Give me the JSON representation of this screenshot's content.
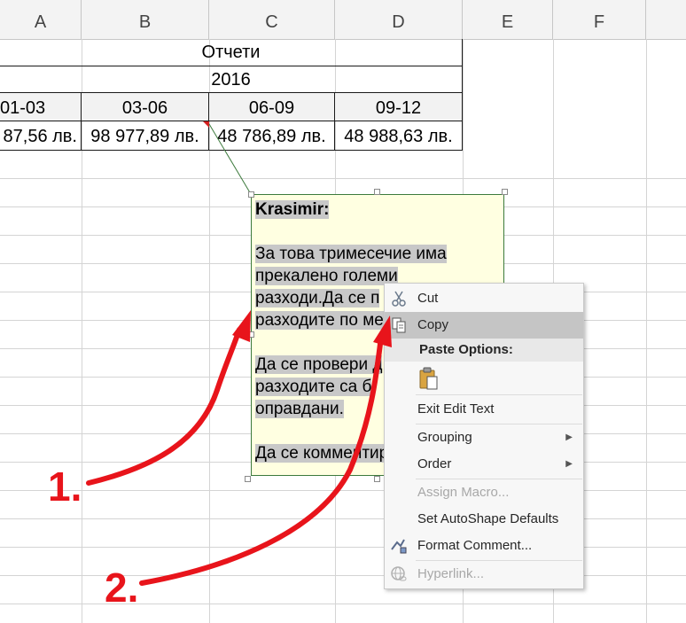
{
  "columns": [
    "A",
    "B",
    "C",
    "D",
    "E",
    "F"
  ],
  "table": {
    "title": "Отчети",
    "year": "2016",
    "periods": [
      "01-03",
      "03-06",
      "06-09",
      "09-12"
    ],
    "values": [
      "87,56 лв.",
      "98 977,89 лв.",
      "48 786,89 лв.",
      "48 988,63 лв."
    ]
  },
  "comment": {
    "author": "Krasimir:",
    "lines1": [
      "За това тримесечие има",
      "прекалено големи",
      "разходи.Да се п",
      "разходите по ме"
    ],
    "lines2": [
      "Да се провери д",
      "разходите са б",
      "оправдани."
    ],
    "lines3": [
      "Да се комментир"
    ]
  },
  "context_menu": {
    "cut": "Cut",
    "copy": "Copy",
    "paste_options": "Paste Options:",
    "exit_edit_text": "Exit Edit Text",
    "grouping": "Grouping",
    "order": "Order",
    "assign_macro": "Assign Macro...",
    "set_autoshape_defaults": "Set AutoShape Defaults",
    "format_comment": "Format Comment...",
    "hyperlink": "Hyperlink..."
  },
  "icons": {
    "cut": "scissors-icon",
    "copy": "copy-icon",
    "paste": "clipboard-icon",
    "format_comment": "format-comment-icon",
    "hyperlink": "globe-link-icon"
  },
  "callouts": [
    "1.",
    "2."
  ],
  "colors": {
    "comment_bg": "#ffffe1",
    "comment_border": "#3c7a3c",
    "annotation_red": "#e8141b",
    "menu_hover": "#c5c5c5"
  }
}
